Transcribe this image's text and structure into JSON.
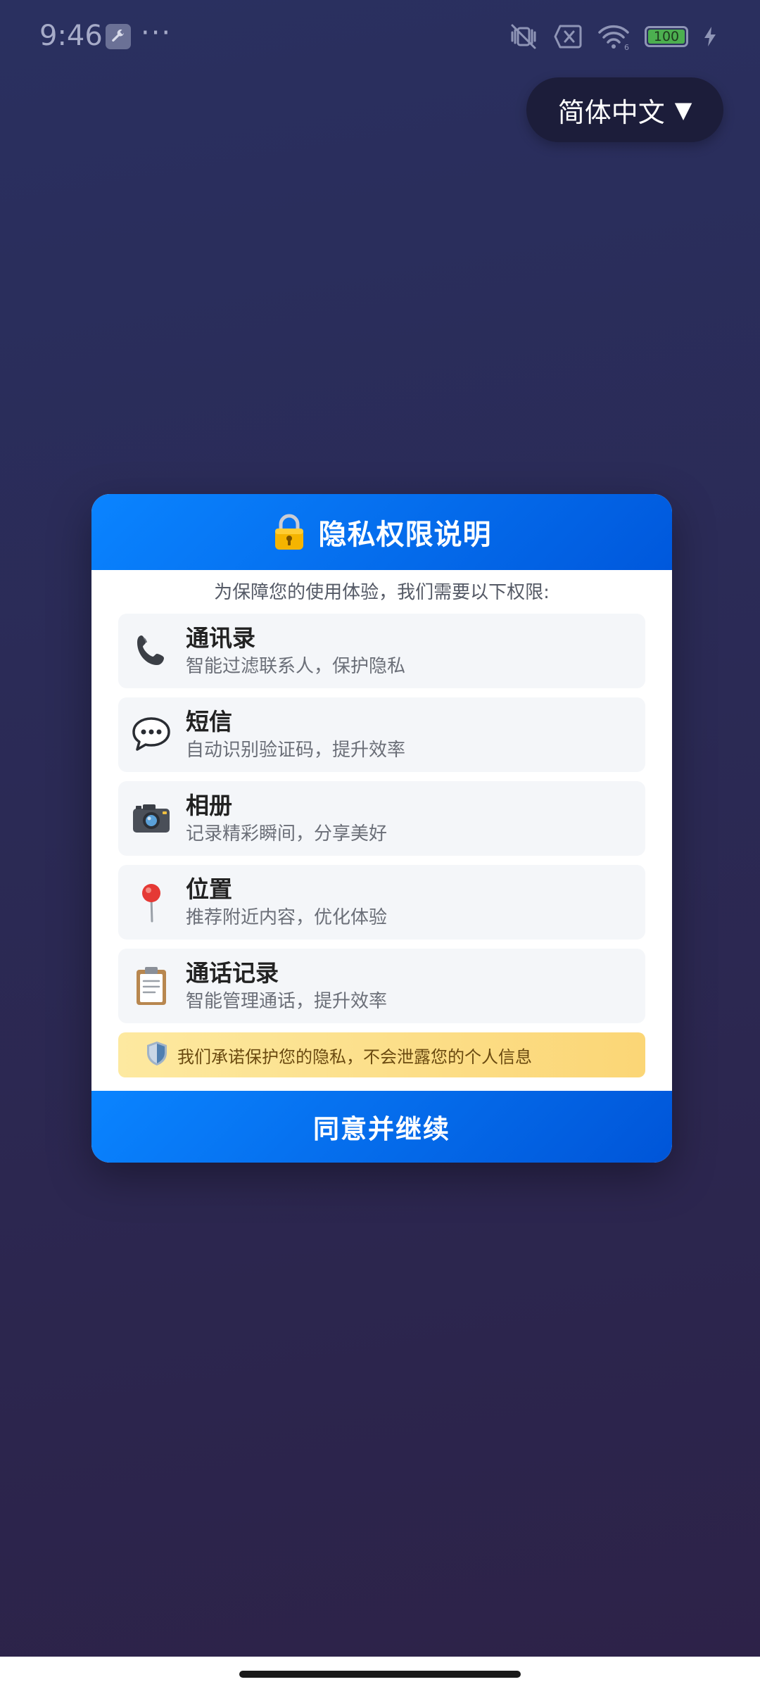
{
  "status_bar": {
    "time": "9:46",
    "dots": "···",
    "battery": "100",
    "icons": [
      "wrench-icon",
      "vibrate-off-icon",
      "no-sim-icon",
      "wifi-icon",
      "battery-icon",
      "charging-icon"
    ]
  },
  "language": {
    "label": "简体中文",
    "arrow": "▼"
  },
  "dialog": {
    "title": "隐私权限说明",
    "subtitle": "为保障您的使用体验，我们需要以下权限:",
    "permissions": [
      {
        "title": "通讯录",
        "desc": "智能过滤联系人，保护隐私",
        "icon": "phone-icon"
      },
      {
        "title": "短信",
        "desc": "自动识别验证码，提升效率",
        "icon": "speech-bubble-icon"
      },
      {
        "title": "相册",
        "desc": "记录精彩瞬间，分享美好",
        "icon": "camera-icon"
      },
      {
        "title": "位置",
        "desc": "推荐附近内容，优化体验",
        "icon": "location-pin-icon"
      },
      {
        "title": "通话记录",
        "desc": "智能管理通话，提升效率",
        "icon": "clipboard-icon"
      }
    ],
    "promise": "我们承诺保护您的隐私，不会泄露您的个人信息",
    "agree_button": "同意并继续"
  },
  "colors": {
    "accent": "#0a84ff",
    "background": "#2b2a55",
    "promise_bg": "#fcdf8a"
  }
}
